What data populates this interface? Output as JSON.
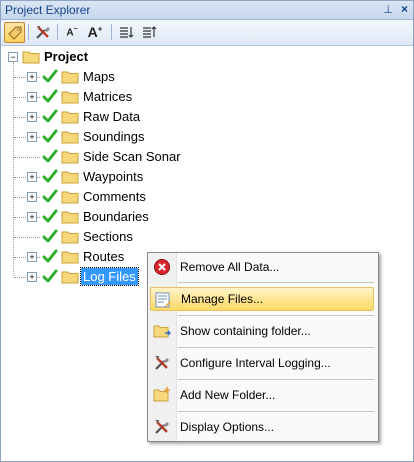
{
  "panel": {
    "title": "Project Explorer",
    "pin_glyph": "⊥",
    "close_glyph": "×"
  },
  "toolbar": {
    "buttons": [
      {
        "name": "tag-icon"
      },
      {
        "name": "tools-icon"
      },
      {
        "name": "font-decrease-icon",
        "text": "A"
      },
      {
        "name": "font-increase-icon",
        "text": "A"
      },
      {
        "name": "sort-ascending-icon"
      },
      {
        "name": "sort-descending-icon"
      }
    ],
    "font_small_glyph": "A",
    "font_large_glyph": "A"
  },
  "tree": {
    "root": {
      "label": "Project",
      "expanded": true
    },
    "items": [
      {
        "label": "Maps",
        "expandable": true,
        "checked": true
      },
      {
        "label": "Matrices",
        "expandable": true,
        "checked": true
      },
      {
        "label": "Raw Data",
        "expandable": true,
        "checked": true
      },
      {
        "label": "Soundings",
        "expandable": true,
        "checked": true
      },
      {
        "label": "Side Scan Sonar",
        "expandable": false,
        "checked": true
      },
      {
        "label": "Waypoints",
        "expandable": true,
        "checked": true
      },
      {
        "label": "Comments",
        "expandable": true,
        "checked": true
      },
      {
        "label": "Boundaries",
        "expandable": true,
        "checked": true
      },
      {
        "label": "Sections",
        "expandable": false,
        "checked": true
      },
      {
        "label": "Routes",
        "expandable": true,
        "checked": true
      },
      {
        "label": "Log Files",
        "expandable": true,
        "checked": true,
        "selected": true
      }
    ]
  },
  "context_menu": {
    "items": [
      {
        "label": "Remove All Data...",
        "icon": "remove-icon"
      },
      {
        "label": "Manage Files...",
        "icon": "manage-files-icon",
        "highlighted": true
      },
      {
        "label": "Show containing folder...",
        "icon": "folder-open-icon"
      },
      {
        "label": "Configure Interval Logging...",
        "icon": "tools-icon"
      },
      {
        "label": "Add New Folder...",
        "icon": "add-folder-icon"
      },
      {
        "label": "Display Options...",
        "icon": "tools-icon"
      }
    ]
  },
  "colors": {
    "selection": "#3399ff",
    "check": "#2eae2e",
    "folder": "#f6d77a",
    "menu_highlight": "#ffd964"
  }
}
